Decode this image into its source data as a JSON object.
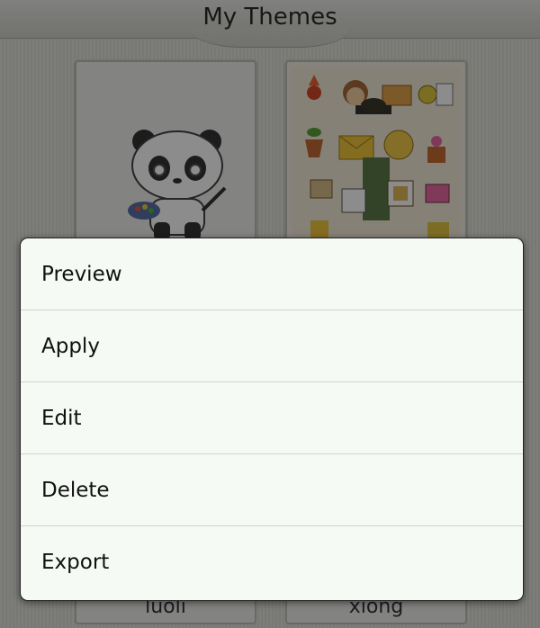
{
  "header": {
    "title": "My Themes"
  },
  "themes": [
    {
      "name": "luoli"
    },
    {
      "name": "xiong"
    }
  ],
  "context_menu": {
    "items": [
      {
        "label": "Preview"
      },
      {
        "label": "Apply"
      },
      {
        "label": "Edit"
      },
      {
        "label": "Delete"
      },
      {
        "label": "Export"
      }
    ]
  }
}
